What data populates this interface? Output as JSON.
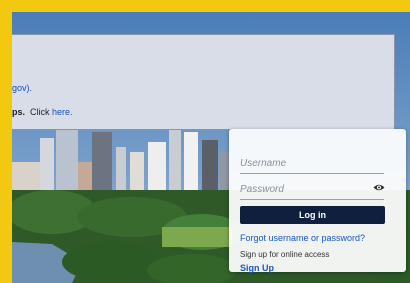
{
  "notice": {
    "line1": "gov).",
    "line2_bold": "ps.",
    "line2_text": "Click",
    "line2_link": "here."
  },
  "login": {
    "username_placeholder": "Username",
    "password_placeholder": "Password",
    "login_button": "Log in",
    "forgot_link": "Forgot username or password?",
    "signup_prompt": "Sign up for online access",
    "signup_link": "Sign Up"
  },
  "colors": {
    "border": "#f2c811",
    "button": "#0f1f3d",
    "link": "#1a56c4"
  },
  "icons": [
    "eye-icon"
  ]
}
